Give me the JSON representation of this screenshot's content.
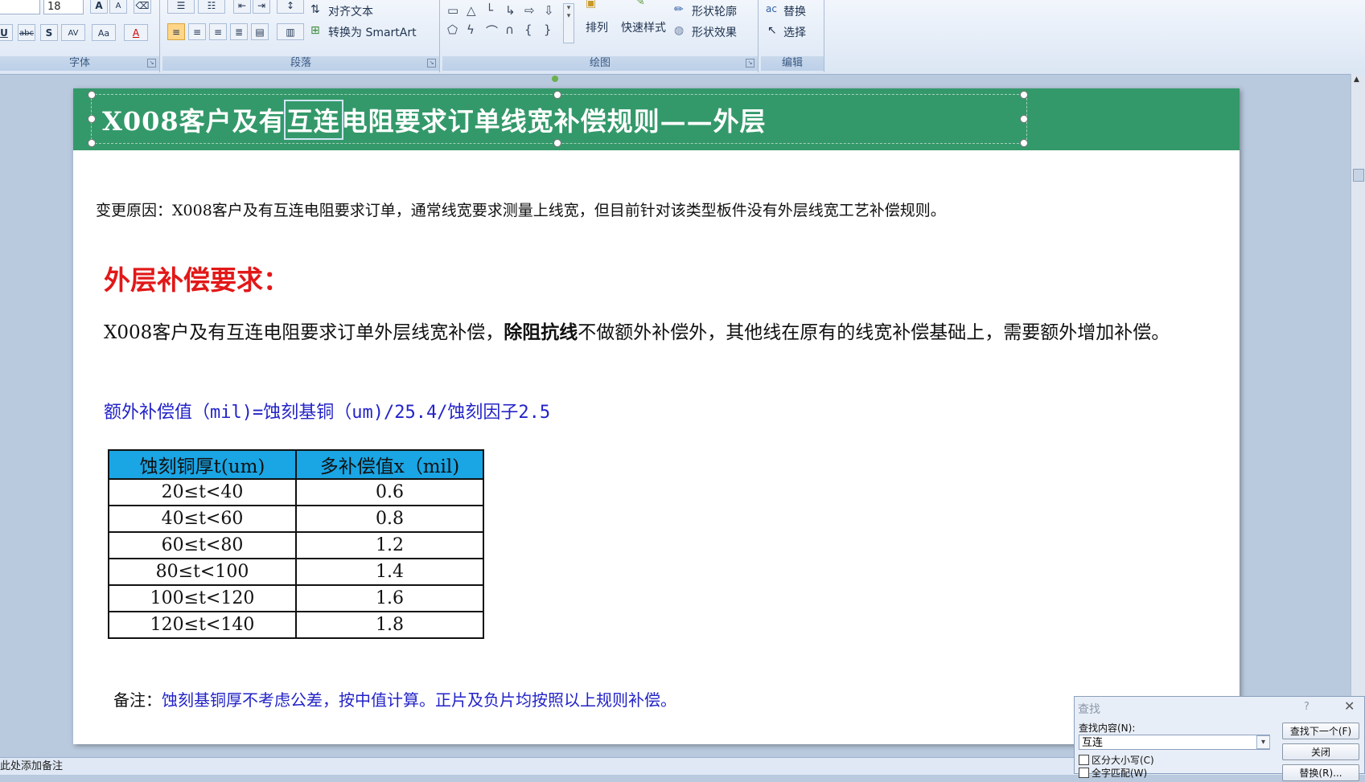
{
  "ribbon": {
    "font_group": {
      "label": "字体",
      "font_size": "18",
      "buttons": [
        "A",
        "A",
        "U",
        "abc",
        "S",
        "AV",
        "Aa",
        "A"
      ]
    },
    "paragraph_group": {
      "label": "段落",
      "align_text": "对齐文本",
      "smartart": "转换为 SmartArt"
    },
    "drawing_group": {
      "label": "绘图",
      "arrange": "排列",
      "quick_styles": "快速样式",
      "shape_outline": "形状轮廓",
      "shape_effects": "形状效果"
    },
    "edit_group": {
      "label": "编辑",
      "replace": "替换",
      "select": "选择"
    }
  },
  "slide": {
    "title_pre": "X008客户及有",
    "title_hl": "互连",
    "title_post": "电阻要求订单线宽补偿规则——外层",
    "reason": "变更原因：X008客户及有互连电阻要求订单，通常线宽要求测量上线宽，但目前针对该类型板件没有外层线宽工艺补偿规则。",
    "outer_heading": "外层补偿要求：",
    "p1_a": "X008客户及有互连电阻要求订单外层线宽补偿，",
    "p1_bold": "除阻抗线",
    "p1_b": "不做额外补偿外，其他线在原有的线宽补偿基础上，需要额外增加补偿。",
    "formula": "额外补偿值（mil)=蚀刻基铜（um)/25.4/蚀刻因子2.5",
    "table": {
      "headers": [
        "蚀刻铜厚t(um)",
        "多补偿值x（mil)"
      ],
      "rows": [
        [
          "20≤t<40",
          "0.6"
        ],
        [
          "40≤t<60",
          "0.8"
        ],
        [
          "60≤t<80",
          "1.2"
        ],
        [
          "80≤t<100",
          "1.4"
        ],
        [
          "100≤t<120",
          "1.6"
        ],
        [
          "120≤t<140",
          "1.8"
        ]
      ]
    },
    "note_label": "备注：",
    "note_text": "蚀刻基铜厚不考虑公差，按中值计算。正片及负片均按照以上规则补偿。"
  },
  "status": {
    "text": "此处添加备注"
  },
  "find_dialog": {
    "title": "查找",
    "help": "?",
    "close": "✕",
    "find_label": "查找内容(N):",
    "find_value": "互连",
    "find_next": "查找下一个(F)",
    "close_button": "关闭",
    "replace_button": "替换(R)...",
    "match_case": "区分大小写(C)",
    "whole_word": "全字匹配(W)"
  }
}
